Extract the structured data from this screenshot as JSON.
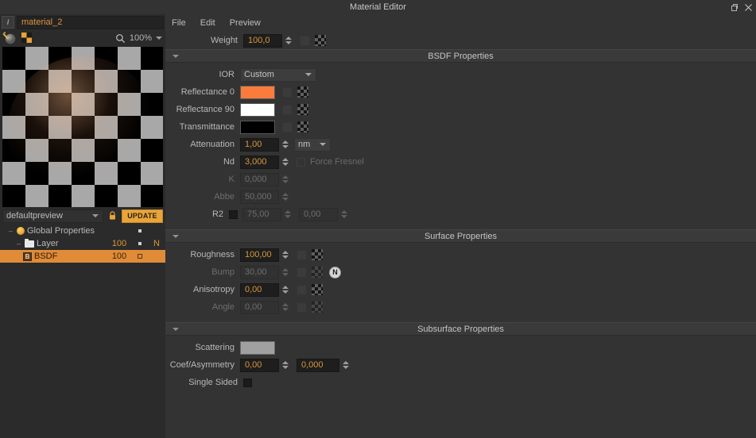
{
  "window": {
    "title": "Material Editor",
    "restore_icon": "restore-window-icon",
    "close_icon": "close-window-icon"
  },
  "left": {
    "material_name": "material_2",
    "name_icon": "text-field-icon",
    "tools": {
      "lighting_icon": "lighting-sphere-icon",
      "checker_icon": "checkerboard-icon",
      "search_icon": "search-icon",
      "zoom_level": "100%",
      "zoom_caret_icon": "chevron-down-icon"
    },
    "preview": {
      "sphere_color": "#e07a3f",
      "background": "checkerboard"
    },
    "preview_bar": {
      "preset": "defaultpreview",
      "preset_caret_icon": "chevron-down-icon",
      "lock_icon": "lock-icon",
      "update_label": "UPDATE"
    },
    "tree": {
      "columns": [
        "name",
        "value",
        "mark",
        "flag"
      ],
      "rows": [
        {
          "label": "Global Properties",
          "icon": "sun-icon",
          "twisty": "-",
          "value": "",
          "dot": "square",
          "flag": "",
          "selected": false,
          "indent": 0
        },
        {
          "label": "Layer",
          "icon": "folder-icon",
          "twisty": "-",
          "value": "100",
          "dot": "square",
          "flag": "N",
          "selected": false,
          "indent": 1
        },
        {
          "label": "BSDF",
          "icon": "bsdf-icon",
          "twisty": "",
          "value": "100",
          "dot": "box",
          "flag": "",
          "selected": true,
          "indent": 2
        }
      ]
    }
  },
  "menubar": {
    "items": [
      {
        "label": "File"
      },
      {
        "label": "Edit"
      },
      {
        "label": "Preview"
      }
    ]
  },
  "weight_row": {
    "label": "Weight",
    "value": "100,0",
    "map_button_icon": "map-slot-icon",
    "texture_icon": "checkerboard-icon"
  },
  "sections": [
    {
      "title": "BSDF Properties",
      "twisty_icon": "chevron-down-icon"
    },
    {
      "title": "Surface Properties",
      "twisty_icon": "chevron-down-icon"
    },
    {
      "title": "Subsurface Properties",
      "twisty_icon": "chevron-down-icon"
    }
  ],
  "bsdf": {
    "ior": {
      "label": "IOR",
      "value": "Custom",
      "caret_icon": "chevron-down-icon"
    },
    "reflectance0": {
      "label": "Reflectance 0",
      "color": "#f97c3c"
    },
    "reflectance90": {
      "label": "Reflectance 90",
      "color": "#ffffff"
    },
    "transmittance": {
      "label": "Transmittance",
      "color": "#000000"
    },
    "attenuation": {
      "label": "Attenuation",
      "value": "1,00",
      "unit": "nm",
      "unit_caret_icon": "chevron-down-icon"
    },
    "nd": {
      "label": "Nd",
      "value": "3,000"
    },
    "force_fresnel": {
      "label": "Force Fresnel",
      "checked": false
    },
    "k": {
      "label": "K",
      "value": "0,000",
      "disabled": true
    },
    "abbe": {
      "label": "Abbe",
      "value": "50,000",
      "disabled": true
    },
    "r2": {
      "label": "R2",
      "checked": false,
      "value1": "75,00",
      "value2": "0,00",
      "disabled": true
    }
  },
  "surface": {
    "roughness": {
      "label": "Roughness",
      "value": "100,00"
    },
    "bump": {
      "label": "Bump",
      "value": "30,00",
      "disabled": true,
      "normal_button": "N"
    },
    "anisotropy": {
      "label": "Anisotropy",
      "value": "0,00"
    },
    "angle": {
      "label": "Angle",
      "value": "0,00",
      "disabled": true
    }
  },
  "subsurface": {
    "scattering": {
      "label": "Scattering",
      "color": "#a0a0a0"
    },
    "coef_asymmetry": {
      "label": "Coef/Asymmetry",
      "value1": "0,00",
      "value2": "0,000"
    },
    "single_sided": {
      "label": "Single Sided",
      "checked": false
    }
  }
}
